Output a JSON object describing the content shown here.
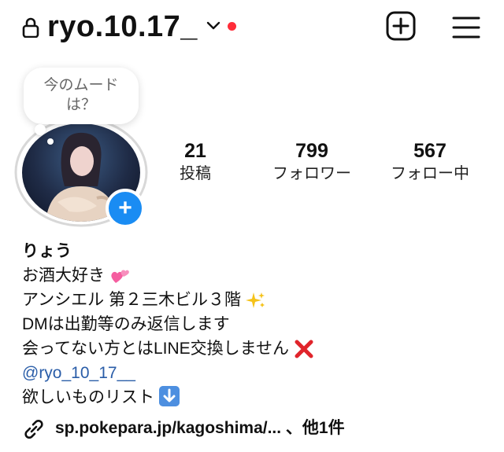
{
  "header": {
    "username": "ryo.10.17_",
    "icons": [
      "lock-icon",
      "chevron-down-icon",
      "notification-dot",
      "plus-square-icon",
      "menu-icon"
    ],
    "accent_colors": {
      "dot": "#ff2d39",
      "add_badge": "#1a8cf3",
      "link": "#2a5da8"
    }
  },
  "profile": {
    "mood_bubble": {
      "line1": "今のムード",
      "line2": "は？"
    },
    "stats": [
      {
        "value": "21",
        "label": "投稿"
      },
      {
        "value": "799",
        "label": "フォロワー"
      },
      {
        "value": "567",
        "label": "フォロー中"
      }
    ]
  },
  "bio": {
    "name": "りょう",
    "line1": "お酒大好き",
    "line2": "アンシエル 第２三木ビル３階",
    "line3": "DMは出勤等のみ返信します",
    "line4": "会ってない方とはLINE交換しません",
    "mention": "@ryo_10_17__",
    "line6": "欲しいものリスト",
    "link": "sp.pokepara.jp/kagoshima/... 、他1件"
  }
}
